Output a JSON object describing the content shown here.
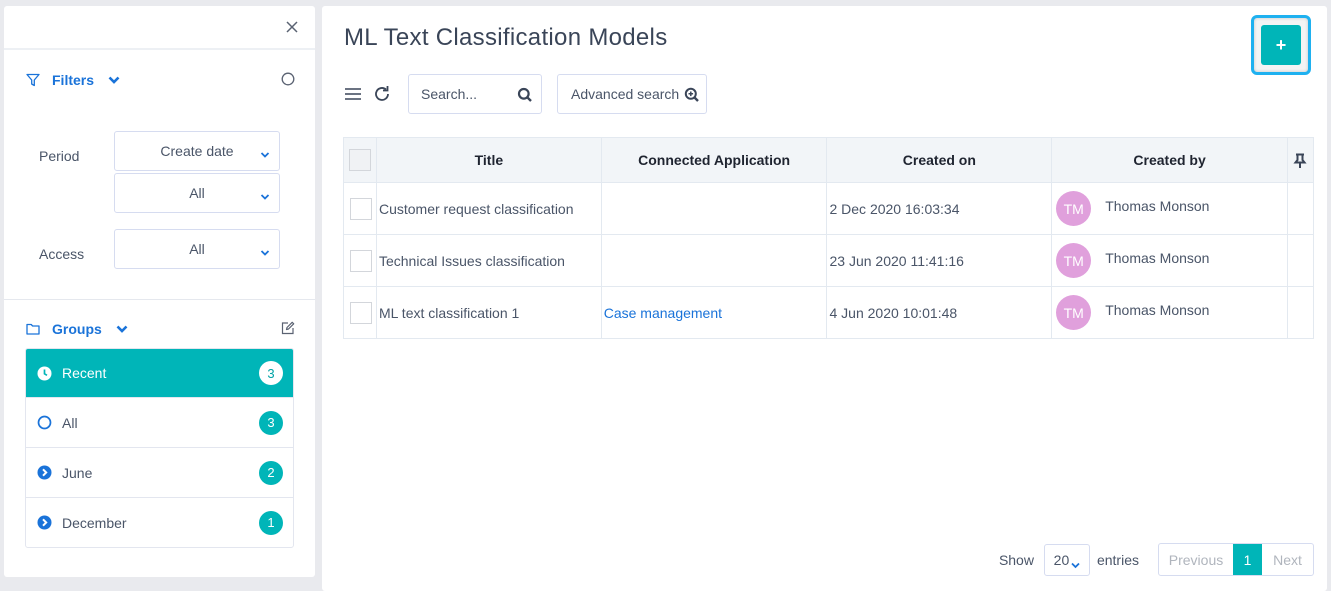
{
  "sidebar": {
    "filters": {
      "label": "Filters",
      "period_label": "Period",
      "period_type": "Create date",
      "period_value": "All",
      "access_label": "Access",
      "access_value": "All"
    },
    "groups": {
      "label": "Groups",
      "items": [
        {
          "label": "Recent",
          "count": "3",
          "icon": "clock-icon",
          "active": true
        },
        {
          "label": "All",
          "count": "3",
          "icon": "circle-icon",
          "active": false
        },
        {
          "label": "June",
          "count": "2",
          "icon": "chevron-circle-right-icon",
          "active": false
        },
        {
          "label": "December",
          "count": "1",
          "icon": "chevron-circle-right-icon",
          "active": false
        }
      ]
    }
  },
  "main": {
    "title": "ML Text Classification Models",
    "add_button": "+",
    "search": {
      "placeholder": "Search...",
      "value": ""
    },
    "advanced_search_label": "Advanced search",
    "table": {
      "columns": [
        "Title",
        "Connected Application",
        "Created on",
        "Created by"
      ],
      "rows": [
        {
          "title": "Customer request classification",
          "app": "",
          "created_on": "2 Dec 2020 16:03:34",
          "initials": "TM",
          "created_by": "Thomas Monson"
        },
        {
          "title": "Technical Issues classification",
          "app": "",
          "created_on": "23 Jun 2020 11:41:16",
          "initials": "TM",
          "created_by": "Thomas Monson"
        },
        {
          "title": "ML text classification 1",
          "app": "Case management",
          "created_on": "4 Jun 2020 10:01:48",
          "initials": "TM",
          "created_by": "Thomas Monson"
        }
      ]
    },
    "footer": {
      "show_label": "Show",
      "page_size": "20",
      "entries_label": "entries",
      "previous": "Previous",
      "current_page": "1",
      "next": "Next"
    }
  },
  "colors": {
    "accent": "#00b5b8",
    "link": "#1a73d9",
    "avatar": "#e0a0dc",
    "highlight_border": "#1fb1f0"
  }
}
